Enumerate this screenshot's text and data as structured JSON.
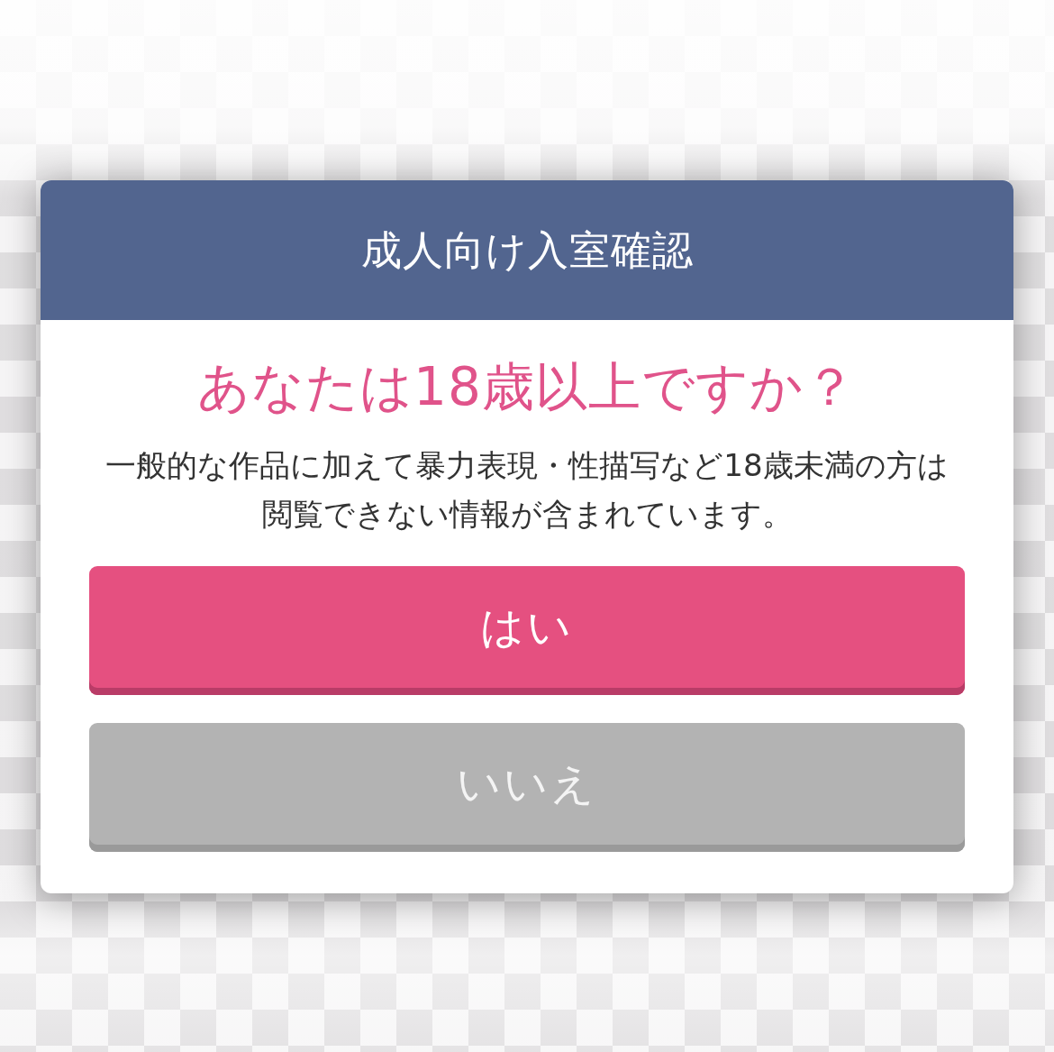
{
  "dialog": {
    "title": "成人向け入室確認",
    "question": "あなたは18歳以上ですか？",
    "message": "一般的な作品に加えて暴力表現・性描写など18歳未満の方は閲覧できない情報が含まれています。",
    "buttons": [
      {
        "label": "はい",
        "kind": "primary"
      },
      {
        "label": "いいえ",
        "kind": "secondary"
      }
    ]
  }
}
